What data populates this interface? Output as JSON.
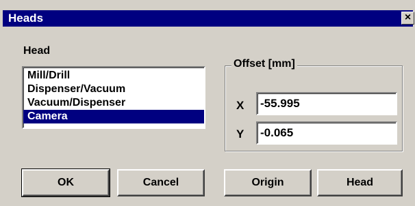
{
  "window": {
    "title": "Heads",
    "close_glyph": "×"
  },
  "head_section": {
    "label": "Head",
    "items": [
      "Mill/Drill",
      "Dispenser/Vacuum",
      "Vacuum/Dispenser",
      "Camera"
    ],
    "selected": "Camera"
  },
  "offset_section": {
    "legend": "Offset [mm]",
    "x_label": "X",
    "x_value": "-55.995",
    "y_label": "Y",
    "y_value": "-0.065"
  },
  "buttons": {
    "ok": "OK",
    "cancel": "Cancel",
    "origin": "Origin",
    "head": "Head"
  },
  "colors": {
    "titlebar": "#000080",
    "face": "#d4d0c8",
    "selection": "#000080"
  }
}
